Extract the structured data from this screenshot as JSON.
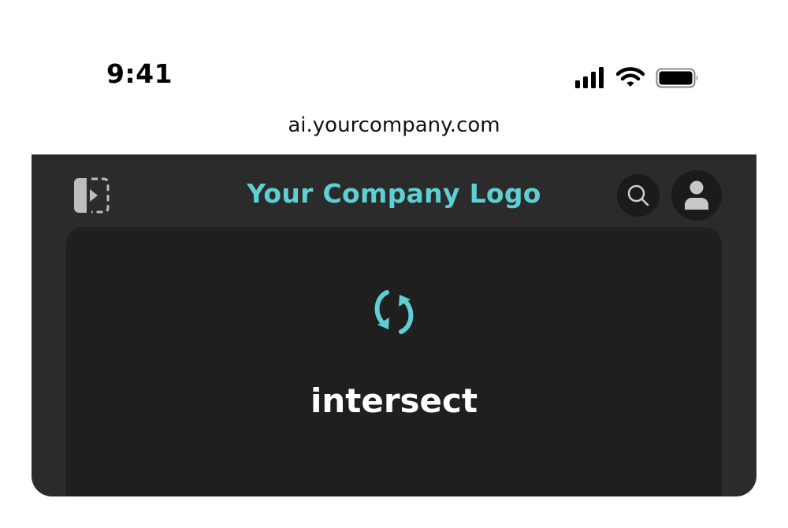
{
  "status_bar": {
    "time": "9:41",
    "icons": [
      "signal-icon",
      "wifi-icon",
      "battery-icon"
    ]
  },
  "browser": {
    "url": "ai.yourcompany.com"
  },
  "header": {
    "logo_text": "Your Company Logo",
    "icons": [
      "sidebar-toggle-icon",
      "search-icon",
      "user-icon"
    ]
  },
  "main": {
    "loading_icon": "sync-icon",
    "loading_text": "intersect"
  },
  "colors": {
    "accent": "#5ecfd3",
    "app_background": "#2b2b2b",
    "panel_background": "#1f1f1f",
    "button_background": "#1b1b1b",
    "icon_gray": "#bdbdbd"
  }
}
